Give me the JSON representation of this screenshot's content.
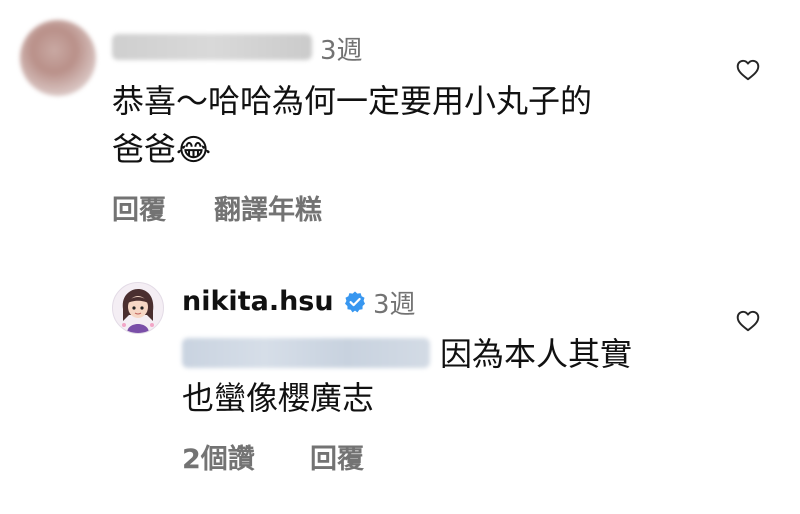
{
  "comments": [
    {
      "time": "3週",
      "text_line1": "恭喜～哈哈為何一定要用小丸子的",
      "text_line2": "爸爸",
      "emoji": "😂",
      "actions": {
        "reply": "回覆",
        "translate": "翻譯年糕"
      }
    },
    {
      "username": "nikita.hsu",
      "verified": true,
      "time": "3週",
      "text_line1": "因為本人其實",
      "text_line2": "也蠻像櫻廣志",
      "actions": {
        "likes": "2個讚",
        "reply": "回覆"
      }
    }
  ],
  "icons": {
    "like": "heart-outline-icon",
    "verified": "verified-badge-icon"
  },
  "colors": {
    "verified_blue": "#3897f0",
    "meta_gray": "#737373"
  }
}
